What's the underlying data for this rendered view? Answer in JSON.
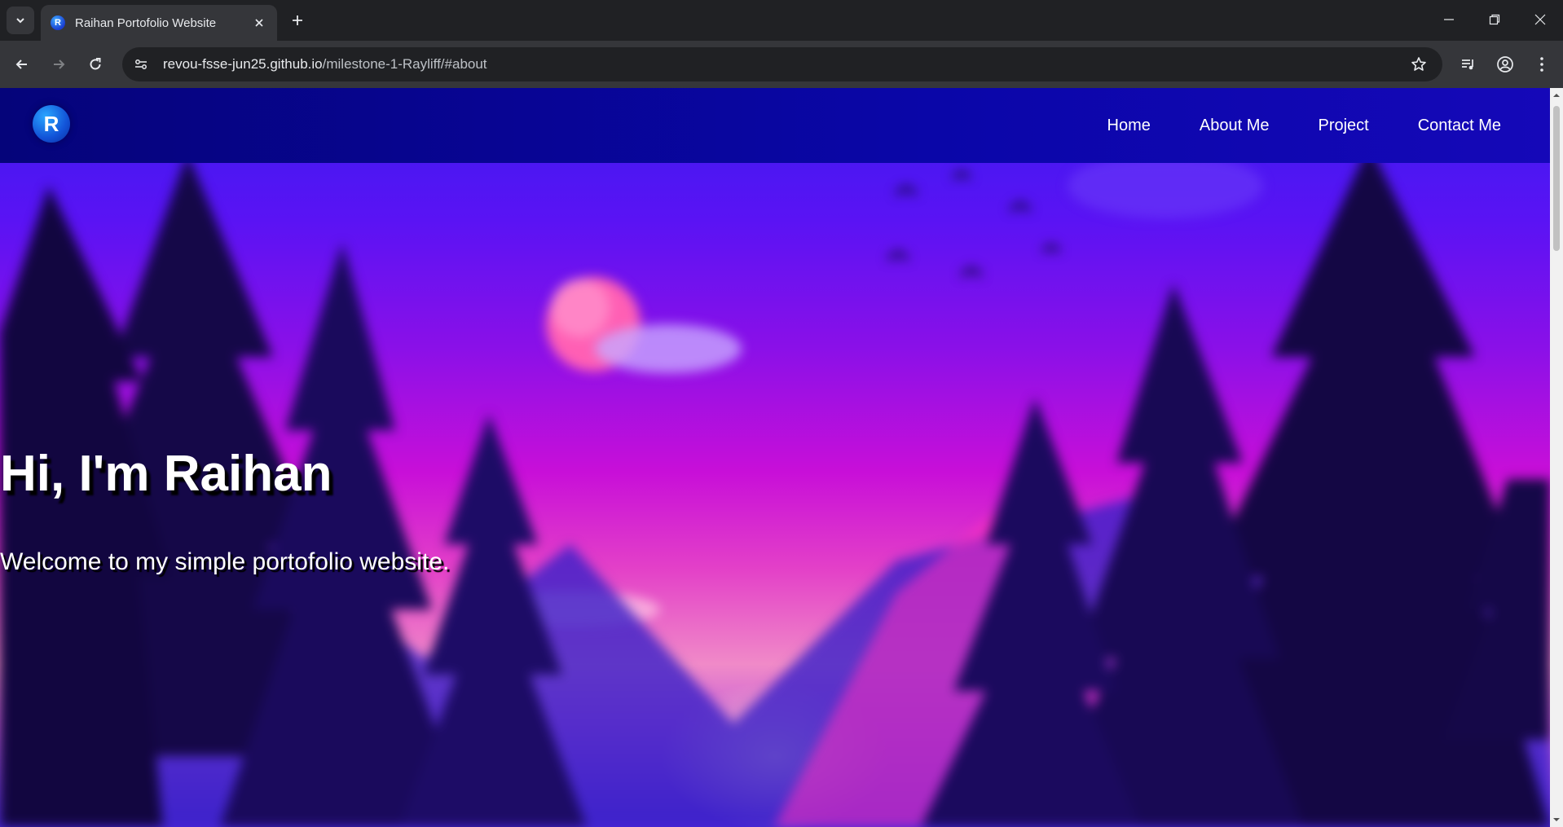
{
  "browser": {
    "tab_title": "Raihan Portofolio Website",
    "favicon_letter": "R",
    "url_host": "revou-fsse-jun25.github.io",
    "url_path": "/milestone-1-Rayliff/#about"
  },
  "site": {
    "logo_letter": "R",
    "nav": [
      {
        "label": "Home"
      },
      {
        "label": "About Me"
      },
      {
        "label": "Project"
      },
      {
        "label": "Contact Me"
      }
    ],
    "hero": {
      "title": "Hi, I'm Raihan",
      "subtitle": "Welcome to my simple portofolio website."
    }
  },
  "colors": {
    "nav_bg": "#0a06a8",
    "accent_pink": "#e340c8",
    "accent_purple": "#5a13f4"
  },
  "icons": [
    "tab-search-icon",
    "close-icon",
    "plus-icon",
    "minimize-icon",
    "restore-icon",
    "window-close-icon",
    "back-icon",
    "forward-icon",
    "reload-icon",
    "site-info-icon",
    "star-icon",
    "media-icon",
    "profile-icon",
    "menu-icon"
  ]
}
